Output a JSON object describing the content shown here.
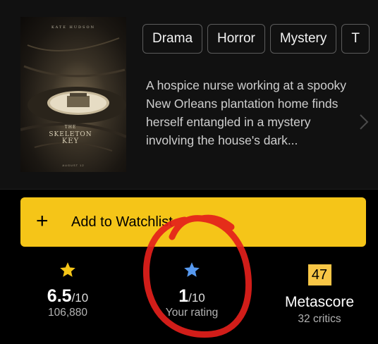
{
  "poster": {
    "top_text": "KATE HUDSON",
    "title_small": "THE",
    "title_main": "SKELETON",
    "title_key": "KEY",
    "date_text": "AUGUST 12"
  },
  "genres": [
    "Drama",
    "Horror",
    "Mystery",
    "T"
  ],
  "plot": "A hospice nurse working at a spooky New Orleans plantation home finds herself entangled in a mystery involving the house's dark...",
  "watchlist": {
    "icon": "plus-icon",
    "label": "Add to Watchlist"
  },
  "imdb_rating": {
    "value": "6.5",
    "scale": "/10",
    "votes": "106,880",
    "icon": "star-icon",
    "color": "#f5c518"
  },
  "your_rating": {
    "value": "1",
    "scale": "/10",
    "label": "Your rating",
    "icon": "star-icon",
    "color": "#5799ef"
  },
  "metascore": {
    "score": "47",
    "label": "Metascore",
    "critics": "32 critics",
    "color": "#f8c646"
  },
  "colors": {
    "accent": "#f5c518",
    "annotation": "#e3201b",
    "background": "#111111"
  }
}
